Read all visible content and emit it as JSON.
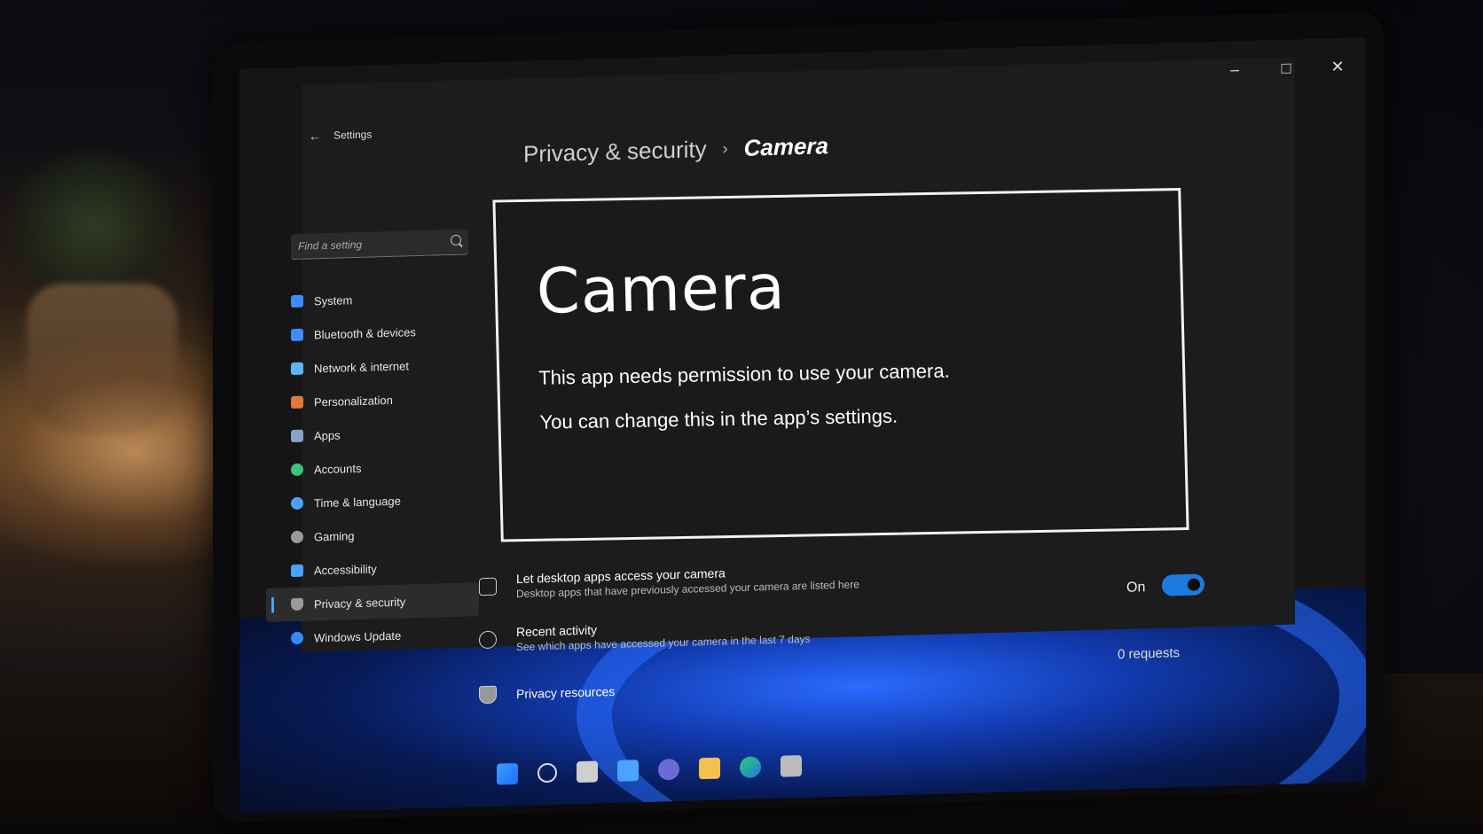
{
  "window": {
    "title": "Settings"
  },
  "search": {
    "placeholder": "Find a setting"
  },
  "sidebar": {
    "items": [
      {
        "label": "System",
        "icon": "system-icon",
        "color": "#3d8bff"
      },
      {
        "label": "Bluetooth & devices",
        "icon": "bluetooth-icon",
        "color": "#3d8bff"
      },
      {
        "label": "Network & internet",
        "icon": "wifi-icon",
        "color": "#5bb4ff"
      },
      {
        "label": "Personalization",
        "icon": "brush-icon",
        "color": "#e07a3a"
      },
      {
        "label": "Apps",
        "icon": "apps-icon",
        "color": "#8aa0c8"
      },
      {
        "label": "Accounts",
        "icon": "accounts-icon",
        "color": "#3cc27a"
      },
      {
        "label": "Time & language",
        "icon": "globe-icon",
        "color": "#4aa3ff"
      },
      {
        "label": "Gaming",
        "icon": "gamepad-icon",
        "color": "#9a9a9a"
      },
      {
        "label": "Accessibility",
        "icon": "accessibility-icon",
        "color": "#4aa3ff"
      },
      {
        "label": "Privacy & security",
        "icon": "shield-icon",
        "color": "#9a9a9a",
        "active": true
      },
      {
        "label": "Windows Update",
        "icon": "update-icon",
        "color": "#2d8cff"
      }
    ]
  },
  "breadcrumb": {
    "parent": "Privacy & security",
    "separator": "›",
    "current": "Camera"
  },
  "dialog": {
    "title": "Camera",
    "line1": "This app needs permission to use your camera.",
    "line2": "You can change this in the app’s settings."
  },
  "settings": {
    "desktop_apps": {
      "title": "Let desktop apps access your camera",
      "desc": "Desktop apps that have previously accessed your camera are listed here"
    },
    "recent_activity": {
      "title": "Recent activity",
      "desc": "See which apps have accessed your camera in the last 7 days"
    },
    "privacy_resources": {
      "title": "Privacy resources"
    }
  },
  "toggle": {
    "label": "On",
    "state": "on"
  },
  "requests": {
    "text": "0 requests"
  },
  "colors": {
    "accent": "#1f7ae0"
  }
}
